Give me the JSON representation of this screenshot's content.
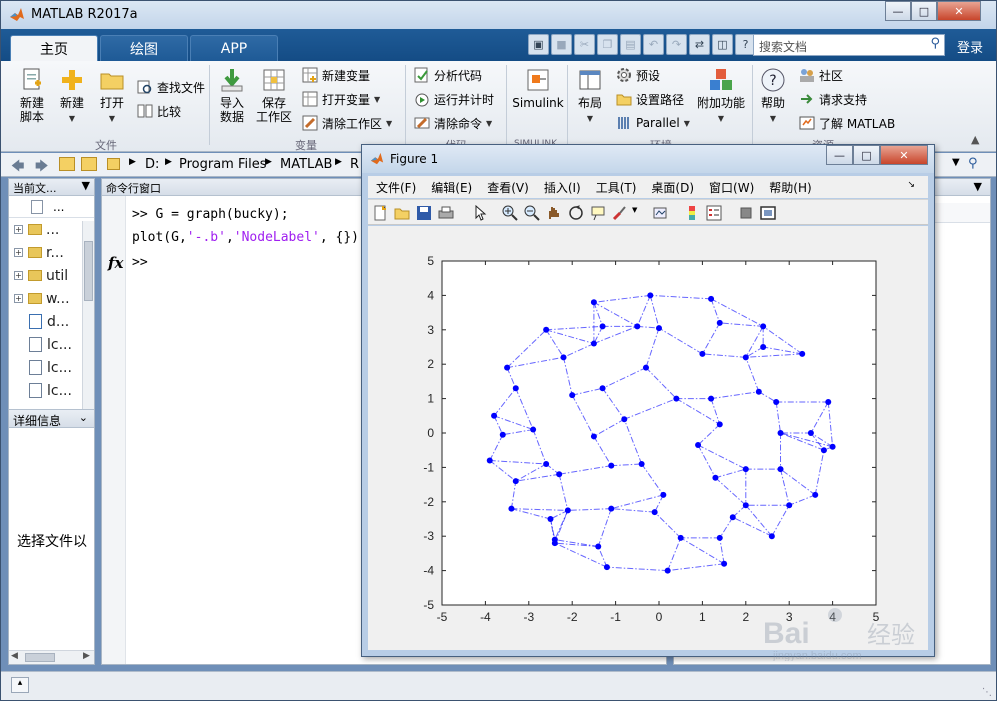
{
  "window": {
    "title": "MATLAB R2017a"
  },
  "tabs": [
    {
      "label": "主页"
    },
    {
      "label": "绘图"
    },
    {
      "label": "APP"
    }
  ],
  "search": {
    "placeholder": "搜索文档"
  },
  "login_label": "登录",
  "ribbon": {
    "file_group": {
      "new_script": "新建\n脚本",
      "new": "新建",
      "open": "打开",
      "find_files": "查找文件",
      "compare": "比较",
      "label": "文件"
    },
    "variable_group": {
      "import_data": "导入\n数据",
      "save_workspace": "保存\n工作区",
      "new_variable": "新建变量",
      "open_variable": "打开变量",
      "clear_workspace": "清除工作区",
      "label": "变量"
    },
    "code_group": {
      "analyze_code": "分析代码",
      "run_and_time": "运行并计时",
      "clear_commands": "清除命令",
      "label": "代码"
    },
    "simulink_group": {
      "simulink": "Simulink",
      "label": "SIMULINK"
    },
    "env_group": {
      "layout": "布局",
      "preferences": "预设",
      "set_path": "设置路径",
      "parallel": "Parallel",
      "addons": "附加功能",
      "label": "环境"
    },
    "resources_group": {
      "help": "帮助",
      "community": "社区",
      "request_support": "请求支持",
      "learn_matlab": "了解 MATLAB",
      "label": "资源"
    }
  },
  "address": {
    "segments": [
      "D:",
      "Program Files",
      "MATLAB",
      "R"
    ]
  },
  "left_panel": {
    "title": "当前文...",
    "column_label": "...",
    "items": [
      {
        "name": "..."
      },
      {
        "name": "r..."
      },
      {
        "name": "util"
      },
      {
        "name": "w..."
      },
      {
        "name": "d..."
      },
      {
        "name": "lc..."
      },
      {
        "name": "lc..."
      },
      {
        "name": "lc..."
      }
    ],
    "details_title": "详细信息",
    "details_hint": "选择文件以"
  },
  "command_window": {
    "title": "命令行窗口",
    "line1": ">> G = graph(bucky);",
    "line2_code": "plot(G,",
    "line2_str1": "'-.b'",
    "line2_sep": ",",
    "line2_str2": "'NodeLabel'",
    "line2_end": ", {})",
    "prompt": ">>",
    "fx": "fx"
  },
  "figure": {
    "title": "Figure 1",
    "menu": [
      "文件(F)",
      "编辑(E)",
      "查看(V)",
      "插入(I)",
      "工具(T)",
      "桌面(D)",
      "窗口(W)",
      "帮助(H)"
    ]
  },
  "chart_data": {
    "type": "scatter",
    "title": "",
    "xlabel": "",
    "ylabel": "",
    "xlim": [
      -5,
      5
    ],
    "ylim": [
      -5,
      5
    ],
    "xticks": [
      -5,
      -4,
      -3,
      -2,
      -1,
      0,
      1,
      2,
      3,
      4,
      5
    ],
    "yticks": [
      -5,
      -4,
      -3,
      -2,
      -1,
      0,
      1,
      2,
      3,
      4,
      5
    ],
    "grid": false,
    "line_style": "-.",
    "color": "#0000ff",
    "nodes": [
      [
        -0.2,
        4.0
      ],
      [
        1.2,
        3.9
      ],
      [
        2.4,
        3.1
      ],
      [
        3.3,
        2.3
      ],
      [
        3.9,
        0.9
      ],
      [
        4.0,
        -0.4
      ],
      [
        3.6,
        -1.8
      ],
      [
        2.6,
        -3.0
      ],
      [
        1.5,
        -3.8
      ],
      [
        0.2,
        -4.0
      ],
      [
        -1.2,
        -3.9
      ],
      [
        -2.4,
        -3.2
      ],
      [
        -3.4,
        -2.2
      ],
      [
        -3.9,
        -0.8
      ],
      [
        -3.8,
        0.5
      ],
      [
        -3.5,
        1.9
      ],
      [
        -2.6,
        3.0
      ],
      [
        -1.5,
        3.8
      ],
      [
        -1.3,
        3.1
      ],
      [
        -0.5,
        3.1
      ],
      [
        0.0,
        3.05
      ],
      [
        1.4,
        3.2
      ],
      [
        2.4,
        2.5
      ],
      [
        2.0,
        2.2
      ],
      [
        1.0,
        2.3
      ],
      [
        -0.3,
        1.9
      ],
      [
        -1.5,
        2.6
      ],
      [
        -2.2,
        2.2
      ],
      [
        -3.3,
        1.3
      ],
      [
        -2.0,
        1.1
      ],
      [
        -1.3,
        1.3
      ],
      [
        0.4,
        1.0
      ],
      [
        1.2,
        1.0
      ],
      [
        2.3,
        1.2
      ],
      [
        2.7,
        0.9
      ],
      [
        3.5,
        0.0
      ],
      [
        3.8,
        -0.5
      ],
      [
        2.8,
        0.0
      ],
      [
        1.4,
        0.25
      ],
      [
        0.9,
        -0.35
      ],
      [
        -0.8,
        0.4
      ],
      [
        -1.5,
        -0.1
      ],
      [
        -2.9,
        0.1
      ],
      [
        -3.6,
        -0.05
      ],
      [
        -2.6,
        -0.9
      ],
      [
        -2.3,
        -1.2
      ],
      [
        -1.1,
        -0.95
      ],
      [
        -0.4,
        -0.9
      ],
      [
        0.1,
        -1.8
      ],
      [
        1.3,
        -1.3
      ],
      [
        2.0,
        -1.05
      ],
      [
        2.8,
        -1.05
      ],
      [
        3.0,
        -2.1
      ],
      [
        2.0,
        -2.1
      ],
      [
        1.7,
        -2.45
      ],
      [
        1.4,
        -3.05
      ],
      [
        0.5,
        -3.05
      ],
      [
        -0.1,
        -2.3
      ],
      [
        -1.1,
        -2.2
      ],
      [
        -1.4,
        -3.3
      ],
      [
        -2.1,
        -2.25
      ],
      [
        -2.5,
        -2.5
      ],
      [
        -2.4,
        -3.1
      ],
      [
        -3.3,
        -1.4
      ]
    ]
  }
}
